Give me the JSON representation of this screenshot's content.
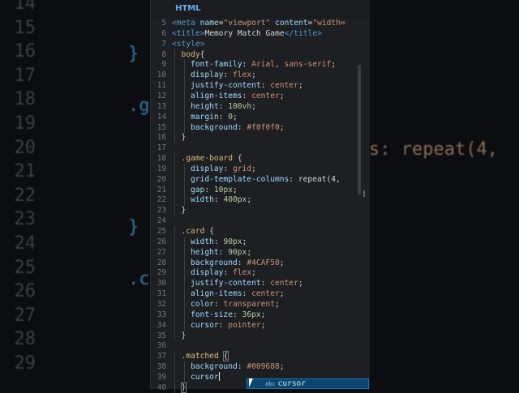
{
  "tab": {
    "label": "HTML"
  },
  "background": {
    "line_numbers": [
      "14",
      "15",
      "16",
      "17",
      "18",
      "19",
      "20",
      "21",
      "22",
      "23",
      "24",
      "25",
      "26",
      "27",
      "28",
      "29"
    ],
    "fragments": [
      "}",
      "}",
      ".g",
      "}",
      ".c"
    ],
    "right_text": "s: repeat(4,"
  },
  "editor": {
    "lines": [
      {
        "n": "5",
        "html": "<span class=\"tag\">&lt;meta</span> <span class=\"attr\">name</span>=<span class=\"str\">\"viewport\"</span> <span class=\"attr\">content</span>=<span class=\"str\">\"width=</span>",
        "indent": 1
      },
      {
        "n": "6",
        "html": "<span class=\"tag\">&lt;title&gt;</span>Memory Match Game<span class=\"tag\">&lt;/title&gt;</span>",
        "indent": 1
      },
      {
        "n": "7",
        "html": "<span class=\"tag\">&lt;style&gt;</span>",
        "indent": 1
      },
      {
        "n": "8",
        "html": "<span class=\"sel\">body</span>{",
        "indent": 2
      },
      {
        "n": "9",
        "html": "<span class=\"prop\">font-family</span>: <span class=\"val\">Arial, sans-serif</span>;",
        "indent": 3
      },
      {
        "n": "10",
        "html": "<span class=\"prop\">display</span>: <span class=\"val\">flex</span>;",
        "indent": 3
      },
      {
        "n": "11",
        "html": "<span class=\"prop\">justify-content</span>: <span class=\"val\">center</span>;",
        "indent": 3
      },
      {
        "n": "12",
        "html": "<span class=\"prop\">align-items</span>: <span class=\"val\">center</span>;",
        "indent": 3
      },
      {
        "n": "13",
        "html": "<span class=\"prop\">height</span>: <span class=\"num\">100vh</span>;",
        "indent": 3
      },
      {
        "n": "14",
        "html": "<span class=\"prop\">margin</span>: <span class=\"num\">0</span>;",
        "indent": 3
      },
      {
        "n": "15",
        "html": "<span class=\"prop\">background</span>: <span class=\"val\">#f0f0f0</span>;",
        "indent": 3
      },
      {
        "n": "16",
        "html": "}",
        "indent": 2
      },
      {
        "n": "17",
        "html": "",
        "indent": 0
      },
      {
        "n": "18",
        "html": "<span class=\"sel\">.game-board</span> {",
        "indent": 2
      },
      {
        "n": "19",
        "html": "<span class=\"prop\">display</span>: <span class=\"val\">grid</span>;",
        "indent": 3
      },
      {
        "n": "20",
        "html": "<span class=\"prop\">grid-template-columns</span>: <span class=\"pun\">repeat(4,</span>",
        "indent": 3
      },
      {
        "n": "21",
        "html": "<span class=\"prop\">gap</span>: <span class=\"num\">10px</span>;",
        "indent": 3
      },
      {
        "n": "22",
        "html": "<span class=\"prop\">width</span>: <span class=\"num\">400px</span>;",
        "indent": 3
      },
      {
        "n": "23",
        "html": "}",
        "indent": 2
      },
      {
        "n": "24",
        "html": "",
        "indent": 0
      },
      {
        "n": "25",
        "html": "<span class=\"sel\">.card</span> {",
        "indent": 2
      },
      {
        "n": "26",
        "html": "<span class=\"prop\">width</span>: <span class=\"num\">90px</span>;",
        "indent": 3
      },
      {
        "n": "27",
        "html": "<span class=\"prop\">height</span>: <span class=\"num\">90px</span>;",
        "indent": 3
      },
      {
        "n": "28",
        "html": "<span class=\"prop\">background</span>: <span class=\"val\">#4CAF50</span>;",
        "indent": 3
      },
      {
        "n": "29",
        "html": "<span class=\"prop\">display</span>: <span class=\"val\">flex</span>;",
        "indent": 3
      },
      {
        "n": "30",
        "html": "<span class=\"prop\">justify-content</span>: <span class=\"val\">center</span>;",
        "indent": 3
      },
      {
        "n": "31",
        "html": "<span class=\"prop\">align-items</span>: <span class=\"val\">center</span>;",
        "indent": 3
      },
      {
        "n": "32",
        "html": "<span class=\"prop\">color</span>: <span class=\"val\">transparent</span>;",
        "indent": 3
      },
      {
        "n": "33",
        "html": "<span class=\"prop\">font-size</span>: <span class=\"num\">36px</span>;",
        "indent": 3
      },
      {
        "n": "34",
        "html": "<span class=\"prop\">cursor</span>: <span class=\"val\">pointer</span>;",
        "indent": 3
      },
      {
        "n": "35",
        "html": "}",
        "indent": 2
      },
      {
        "n": "36",
        "html": "",
        "indent": 0
      },
      {
        "n": "37",
        "html": "<span class=\"sel\">.matched</span> <span class=\"bracket-hl\">{</span>",
        "indent": 2
      },
      {
        "n": "38",
        "html": "<span class=\"prop\">background</span>: <span class=\"val\">#009688</span>;",
        "indent": 3
      },
      {
        "n": "39",
        "html": "<span class=\"prop\">cursor</span><span class=\"caret\"></span>",
        "indent": 3
      },
      {
        "n": "40",
        "html": "<span class=\"bracket-hl\">}</span>",
        "indent": 2
      }
    ]
  },
  "suggestion": {
    "kind": "abc",
    "text": "cursor"
  }
}
